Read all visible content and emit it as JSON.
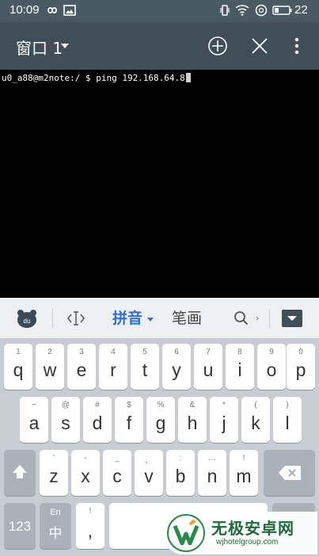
{
  "status_bar": {
    "time": "10:09",
    "battery_level": "22"
  },
  "app_bar": {
    "title": "窗口 1"
  },
  "terminal": {
    "prompt_line": "u0_a88@m2note:/ $ ping 192.168.64.8"
  },
  "keyboard": {
    "toolbar": {
      "cursor_label": "<I>",
      "pinyin_label": "拼音",
      "handwriting_label": "笔画",
      "search_label": "Q"
    },
    "row1": [
      {
        "sub": "1",
        "main": "q"
      },
      {
        "sub": "2",
        "main": "w"
      },
      {
        "sub": "3",
        "main": "e"
      },
      {
        "sub": "4",
        "main": "r"
      },
      {
        "sub": "5",
        "main": "t"
      },
      {
        "sub": "6",
        "main": "y"
      },
      {
        "sub": "7",
        "main": "u"
      },
      {
        "sub": "8",
        "main": "i"
      },
      {
        "sub": "9",
        "main": "o"
      },
      {
        "sub": "0",
        "main": "p"
      }
    ],
    "row2": [
      {
        "sub": "~",
        "main": "a"
      },
      {
        "sub": "@",
        "main": "s"
      },
      {
        "sub": "#",
        "main": "d"
      },
      {
        "sub": "$",
        "main": "f"
      },
      {
        "sub": "%",
        "main": "g"
      },
      {
        "sub": "&",
        "main": "h"
      },
      {
        "sub": "*",
        "main": "j"
      },
      {
        "sub": "(",
        "main": "k"
      },
      {
        "sub": ")",
        "main": "l"
      }
    ],
    "row3": [
      {
        "sub": "'",
        "main": "z"
      },
      {
        "sub": "-",
        "main": "x"
      },
      {
        "sub": "_",
        "main": "c"
      },
      {
        "sub": "、",
        "main": "v"
      },
      {
        "sub": ":",
        "main": "b"
      },
      {
        "sub": "…",
        "main": "n"
      },
      {
        "sub": "!",
        "main": "m"
      }
    ],
    "bottom": {
      "num_label": "123",
      "lang_top": "En",
      "lang_main": "中",
      "punct_top": "!",
      "punct_main": ","
    }
  },
  "watermark": {
    "brand": "无极安卓网",
    "url": "wjhotelgroup.com"
  }
}
